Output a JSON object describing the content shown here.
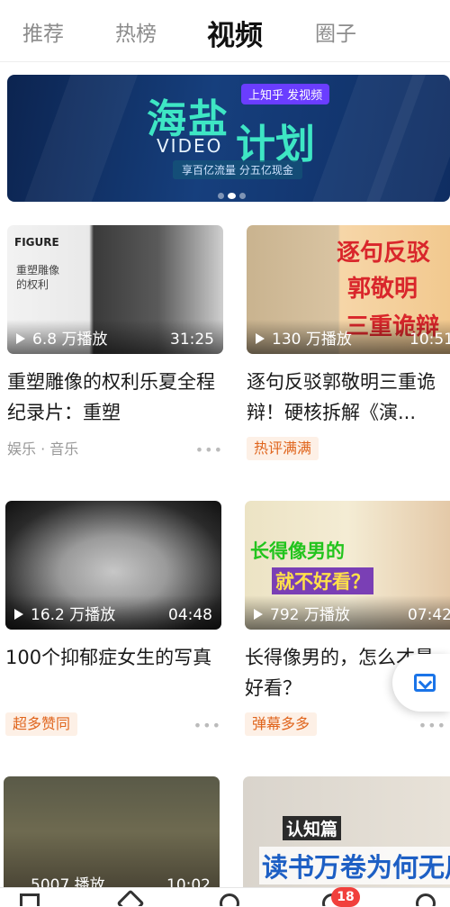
{
  "tabs": [
    {
      "label": "推荐"
    },
    {
      "label": "热榜"
    },
    {
      "label": "视频"
    },
    {
      "label": "圈子"
    }
  ],
  "banner": {
    "tag": "上知乎 发视频",
    "title_a": "海盐",
    "title_b": "计划",
    "video": "VIDEO",
    "subtitle": "享百亿流量   分五亿现金"
  },
  "videos": [
    {
      "views": "6.8 万播放",
      "duration": "31:25",
      "title": "重塑雕像的权利乐夏全程纪录片：重塑",
      "category": "娱乐 · 音乐",
      "thumb_text_1": "FIGURE",
      "thumb_text_2": "重塑雕像的权利"
    },
    {
      "views": "130 万播放",
      "duration": "10:51",
      "title": "逐句反驳郭敬明三重诡辩！硬核拆解《演...",
      "badge": "热评满满",
      "thumb_text_1": "逐句反驳",
      "thumb_text_2": "郭敬明",
      "thumb_text_3": "三重诡辩"
    },
    {
      "views": "16.2 万播放",
      "duration": "04:48",
      "title": "100个抑郁症女生的写真",
      "badge": "超多赞同"
    },
    {
      "views": "792 万播放",
      "duration": "07:42",
      "title": "长得像男的，怎么才最好看？",
      "badge": "弹幕多多",
      "thumb_text_1": "长得像男的",
      "thumb_text_2": "就不好看？"
    },
    {
      "views": "5007 播放",
      "duration": "10:02"
    },
    {
      "thumb_text_1": "认知篇",
      "thumb_text_2": "读书万卷为何无用"
    }
  ],
  "bottom_nav": {
    "badge": "18"
  },
  "colors": {
    "accent_blue": "#1a74e8",
    "badge_orange": "#e0651d",
    "badge_bg": "#fdf0e6",
    "notify_red": "#f1403c"
  }
}
